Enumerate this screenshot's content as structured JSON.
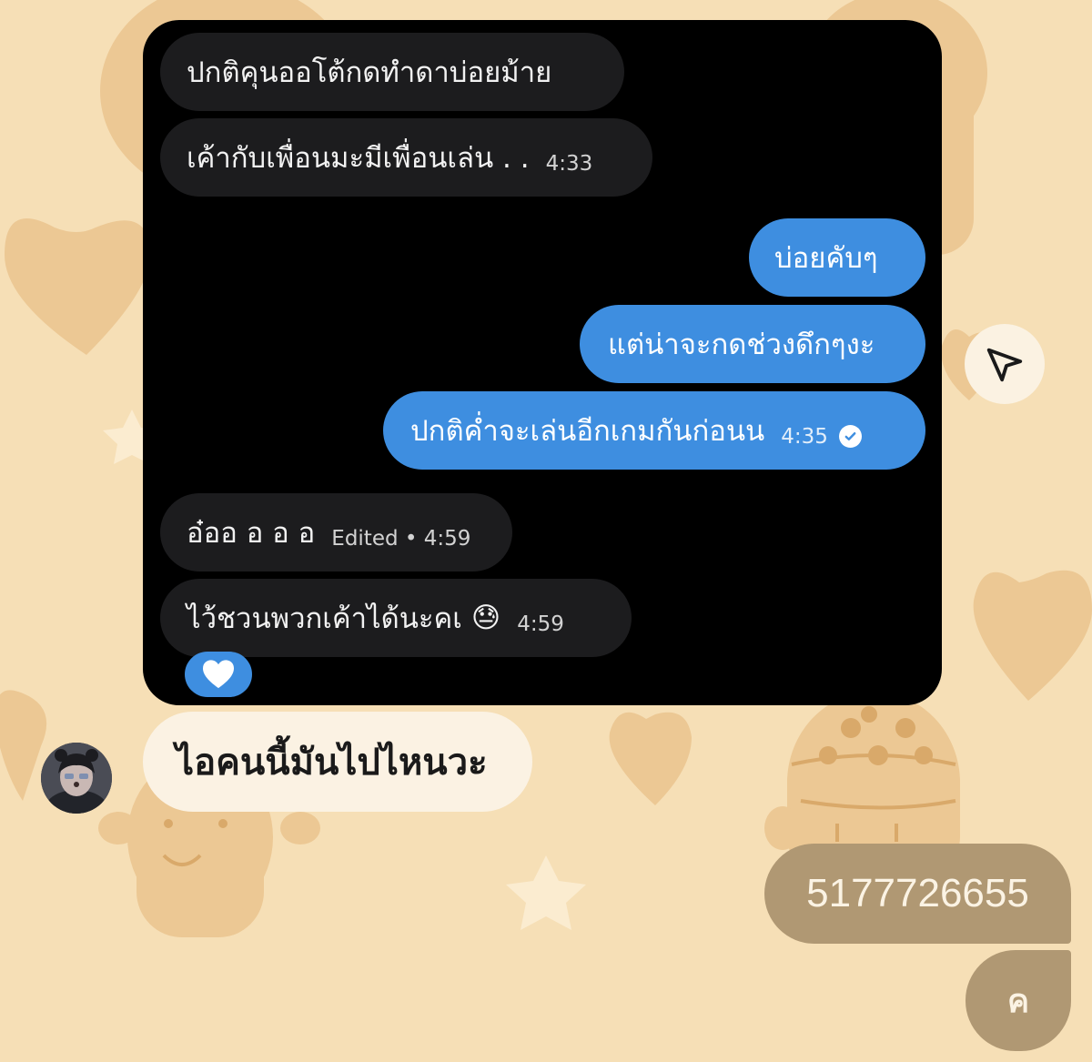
{
  "screenshot_messages": [
    {
      "text": "ปกติคุนออโต้กดทำดาบ่อยม้าย",
      "time": "",
      "direction": "incoming"
    },
    {
      "text": "เค้ากับเพื่อนมะมีเพื่อนเล่น . .",
      "time": "4:33",
      "direction": "incoming"
    },
    {
      "text": "บ่อยคับๆ",
      "time": "",
      "direction": "outgoing"
    },
    {
      "text": "แต่น่าจะกดช่วงดึกๆงะ",
      "time": "",
      "direction": "outgoing"
    },
    {
      "text": "ปกติค่ำจะเล่นอีกเกมกันก่อนน",
      "time": "4:35",
      "direction": "outgoing",
      "read": true
    },
    {
      "text": "อ๋ออ อ อ อ",
      "time": "Edited • 4:59",
      "direction": "incoming"
    },
    {
      "text": "ไว้ชวนพวกเค้าได้นะคเ",
      "emoji": "😓",
      "time": "4:59",
      "direction": "incoming"
    }
  ],
  "reaction": {
    "icon": "white-heart-icon"
  },
  "share_button": {
    "icon": "send-paper-plane-icon"
  },
  "caption": {
    "text": "ไอคนนี้มันไปไหนวะ"
  },
  "replies": [
    {
      "text": "5177726655"
    },
    {
      "text": "ค"
    }
  ],
  "colors": {
    "background": "#f6dfb6",
    "incoming_bubble": "#1c1c1e",
    "outgoing_bubble": "#3e8ee0",
    "reply_bubble": "#b09873",
    "caption_bubble": "#fbf2e3"
  }
}
